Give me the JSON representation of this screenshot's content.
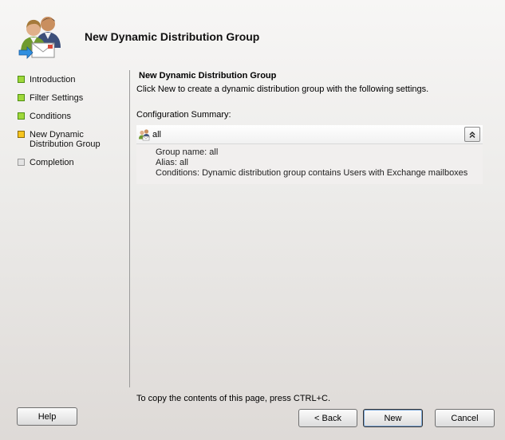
{
  "wizard": {
    "title": "New Dynamic Distribution Group"
  },
  "steps": [
    {
      "label": "Introduction",
      "status": "done"
    },
    {
      "label": "Filter Settings",
      "status": "done"
    },
    {
      "label": "Conditions",
      "status": "done"
    },
    {
      "label": "New Dynamic Distribution Group",
      "status": "current"
    },
    {
      "label": "Completion",
      "status": "pending"
    }
  ],
  "content": {
    "section_title": "New Dynamic Distribution Group",
    "description": "Click New to create a dynamic distribution group with the following settings.",
    "config_label": "Configuration Summary:",
    "summary": {
      "group_name": "all",
      "icon": "group-icon",
      "collapse_icon": "double-chevron-up-icon",
      "lines": [
        "Group name: all",
        "Alias: all",
        "Conditions: Dynamic distribution group contains Users with Exchange mailboxes"
      ]
    }
  },
  "footer_note": "To copy the contents of this page, press CTRL+C.",
  "buttons": {
    "help": "Help",
    "back": "< Back",
    "new": "New",
    "cancel": "Cancel"
  },
  "colors": {
    "step_done": "#9fd83a",
    "step_current": "#f7c51e",
    "step_pending": "#e3e3e3"
  }
}
